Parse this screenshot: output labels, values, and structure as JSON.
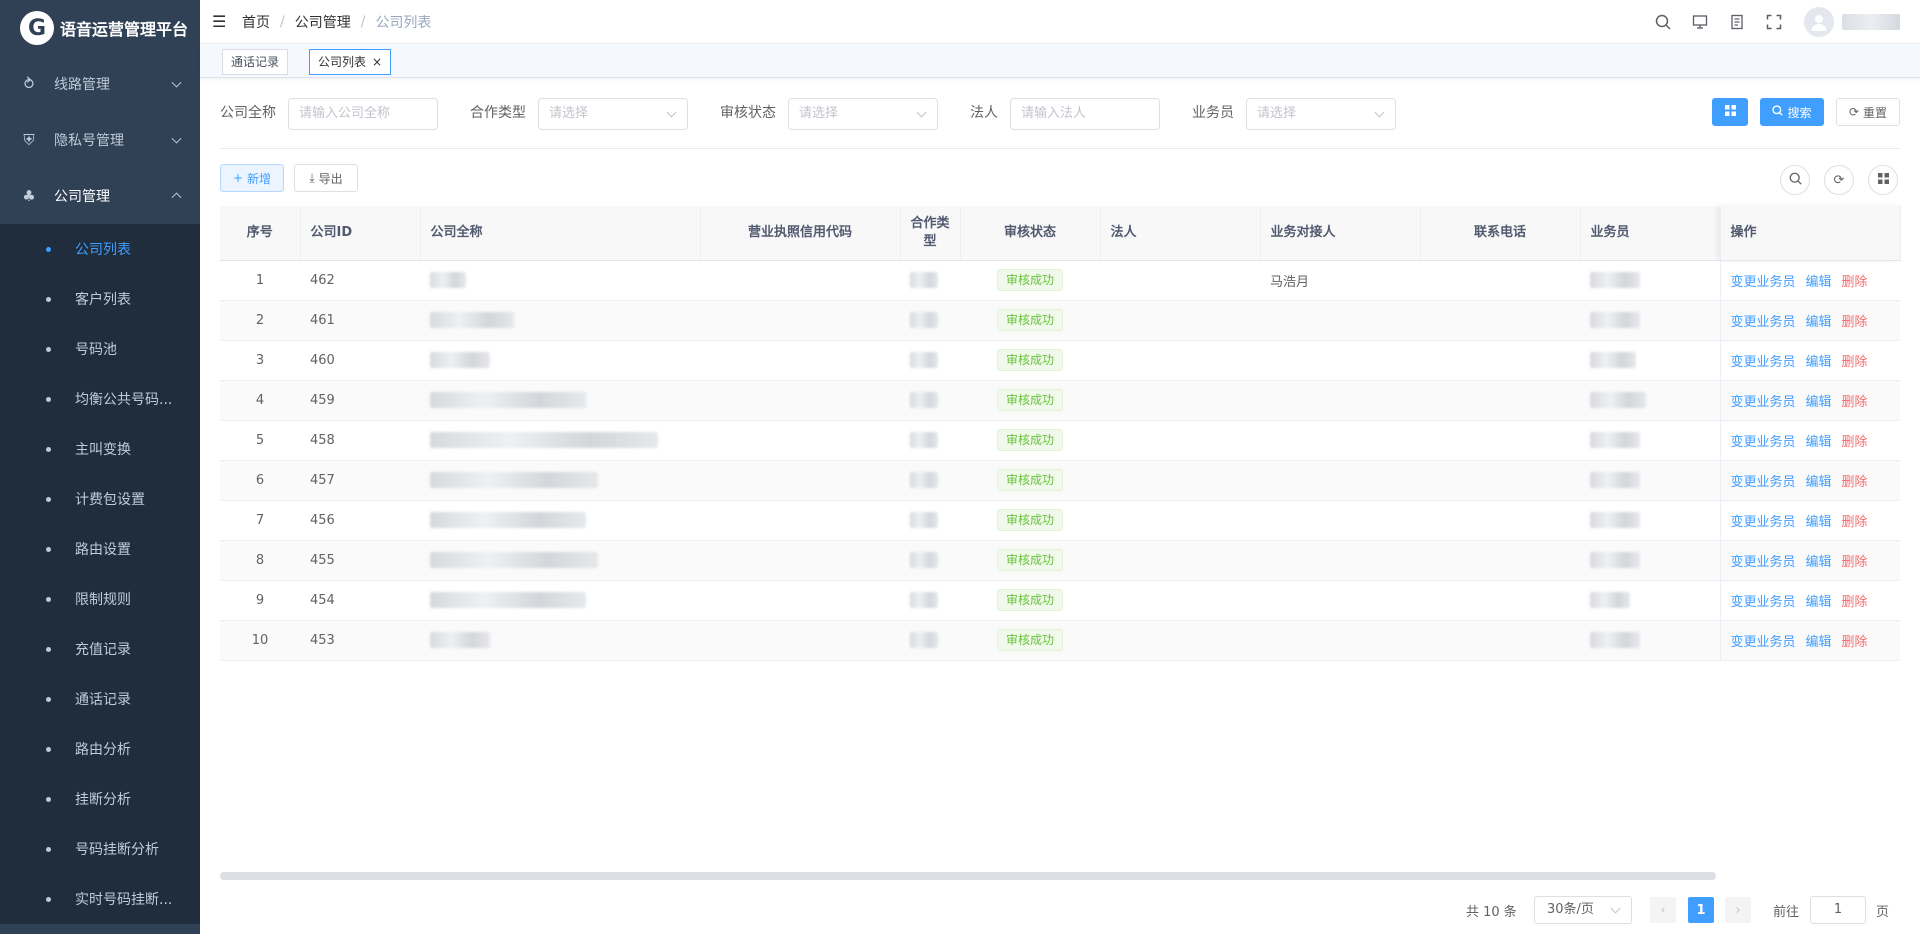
{
  "app": {
    "title": "语音运营管理平台",
    "logo_glyph": "G"
  },
  "sidebar": {
    "menus": [
      {
        "label": "线路管理",
        "icon": "route-icon",
        "glyph": "⥁"
      },
      {
        "label": "隐私号管理",
        "icon": "shield-icon",
        "glyph": "⛨"
      },
      {
        "label": "公司管理",
        "icon": "org-tree-icon",
        "glyph": "♣"
      }
    ],
    "sub_items": [
      "公司列表",
      "客户列表",
      "号码池",
      "均衡公共号码...",
      "主叫变换",
      "计费包设置",
      "路由设置",
      "限制规则",
      "充值记录",
      "通话记录",
      "路由分析",
      "挂断分析",
      "号码挂断分析",
      "实时号码挂断..."
    ],
    "active_sub": "公司列表"
  },
  "header": {
    "breadcrumb": [
      "首页",
      "公司管理",
      "公司列表"
    ],
    "separator": "/"
  },
  "tags": [
    {
      "label": "通话记录"
    },
    {
      "label": "公司列表",
      "close": "×"
    }
  ],
  "filters": {
    "company_name": {
      "label": "公司全称",
      "placeholder": "请输入公司全称"
    },
    "coop_type": {
      "label": "合作类型",
      "placeholder": "请选择"
    },
    "audit_status": {
      "label": "审核状态",
      "placeholder": "请选择"
    },
    "legal_person": {
      "label": "法人",
      "placeholder": "请输入法人"
    },
    "salesman": {
      "label": "业务员",
      "placeholder": "请选择"
    },
    "search_label": "搜索",
    "reset_label": "重置"
  },
  "toolbar": {
    "add_label": "新增",
    "export_label": "导出"
  },
  "table": {
    "headers": {
      "index": "序号",
      "company_id": "公司ID",
      "company_name": "公司全称",
      "license_code": "营业执照信用代码",
      "coop_type": "合作类型",
      "audit_status": "审核状态",
      "legal_person": "法人",
      "contact": "业务对接人",
      "phone": "联系电话",
      "salesman": "业务员",
      "actions": "操作"
    },
    "rows": [
      {
        "index": "1",
        "id": "462",
        "status": "审核成功",
        "contact": "马浩月"
      },
      {
        "index": "2",
        "id": "461",
        "status": "审核成功",
        "contact": ""
      },
      {
        "index": "3",
        "id": "460",
        "status": "审核成功",
        "contact": ""
      },
      {
        "index": "4",
        "id": "459",
        "status": "审核成功",
        "contact": ""
      },
      {
        "index": "5",
        "id": "458",
        "status": "审核成功",
        "contact": ""
      },
      {
        "index": "6",
        "id": "457",
        "status": "审核成功",
        "contact": ""
      },
      {
        "index": "7",
        "id": "456",
        "status": "审核成功",
        "contact": ""
      },
      {
        "index": "8",
        "id": "455",
        "status": "审核成功",
        "contact": ""
      },
      {
        "index": "9",
        "id": "454",
        "status": "审核成功",
        "contact": ""
      },
      {
        "index": "10",
        "id": "453",
        "status": "审核成功",
        "contact": ""
      }
    ],
    "row_actions": {
      "change": "变更业务员",
      "edit": "编辑",
      "delete": "删除"
    }
  },
  "pagination": {
    "total": "共 10 条",
    "page_size": "30条/页",
    "current_page": "1",
    "goto_label": "前往",
    "goto_value": "1",
    "page_suffix": "页"
  },
  "colors": {
    "sidebar_bg": "#304156",
    "submenu_bg": "#1f2d3d",
    "accent": "#409eff",
    "success": "#67c23a",
    "danger": "#f56c6c"
  }
}
